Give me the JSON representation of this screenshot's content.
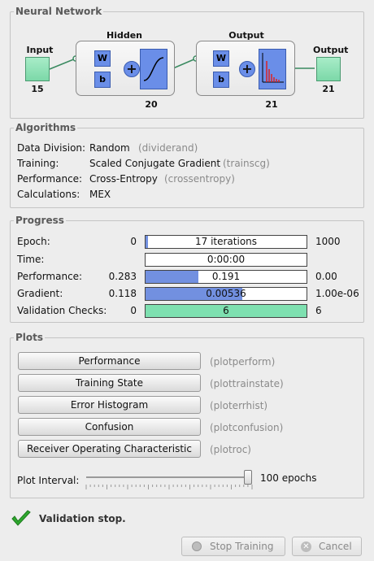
{
  "network": {
    "title": "Neural Network",
    "input_label": "Input",
    "input_size": "15",
    "hidden_label": "Hidden",
    "hidden_size": "20",
    "output_layer_label": "Output",
    "output_layer_size": "21",
    "output_label": "Output",
    "output_size": "21",
    "weight_symbol": "W",
    "bias_symbol": "b",
    "sum_symbol": "+",
    "input_color": "#86dcb0",
    "layer_color": "#6a8ee8"
  },
  "algorithms": {
    "title": "Algorithms",
    "rows": [
      {
        "label": "Data Division:",
        "value": "Random",
        "fn": "(dividerand)"
      },
      {
        "label": "Training:",
        "value": "Scaled Conjugate Gradient",
        "fn": "(trainscg)"
      },
      {
        "label": "Performance:",
        "value": "Cross-Entropy",
        "fn": "(crossentropy)"
      },
      {
        "label": "Calculations:",
        "value": "MEX",
        "fn": ""
      }
    ]
  },
  "progress": {
    "title": "Progress",
    "rows": [
      {
        "label": "Epoch:",
        "start": "0",
        "current": "17 iterations",
        "end": "1000",
        "fill": 0.017,
        "color": "#7290e0"
      },
      {
        "label": "Time:",
        "start": "",
        "current": "0:00:00",
        "end": "",
        "fill": 0,
        "color": "#7290e0"
      },
      {
        "label": "Performance:",
        "start": "0.283",
        "current": "0.191",
        "end": "0.00",
        "fill": 0.33,
        "color": "#7290e0"
      },
      {
        "label": "Gradient:",
        "start": "0.118",
        "current": "0.00536",
        "end": "1.00e-06",
        "fill": 0.6,
        "color": "#7290e0"
      },
      {
        "label": "Validation Checks:",
        "start": "0",
        "current": "6",
        "end": "6",
        "fill": 1.0,
        "color": "#7ee0b0"
      }
    ]
  },
  "plots": {
    "title": "Plots",
    "buttons": [
      {
        "label": "Performance",
        "fn": "(plotperform)"
      },
      {
        "label": "Training State",
        "fn": "(plottrainstate)"
      },
      {
        "label": "Error Histogram",
        "fn": "(ploterrhist)"
      },
      {
        "label": "Confusion",
        "fn": "(plotconfusion)"
      },
      {
        "label": "Receiver Operating Characteristic",
        "fn": "(plotroc)"
      }
    ],
    "interval_label": "Plot Interval:",
    "interval_value": "100 epochs",
    "interval_level": 1.0
  },
  "status": {
    "message": "Validation stop.",
    "color": "#2ea82e"
  },
  "footer": {
    "stop_label": "Stop Training",
    "cancel_label": "Cancel"
  }
}
